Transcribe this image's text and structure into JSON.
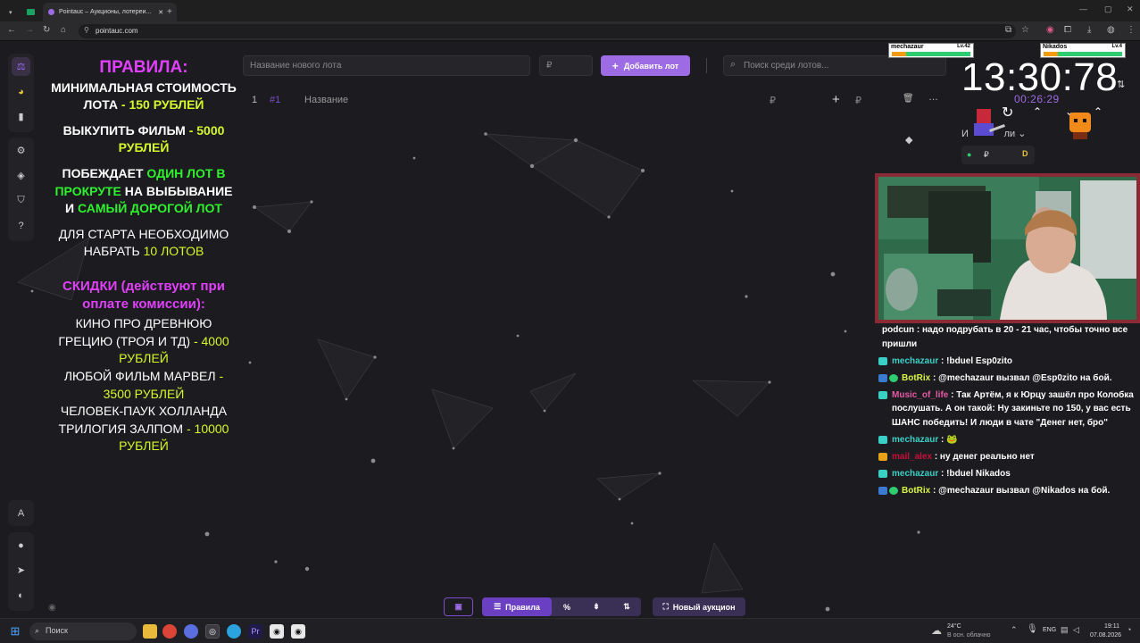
{
  "browser": {
    "tab_label": "Pointauc – Аукционы, лотереи...",
    "new_tab_symbol": "+",
    "url": "pointauc.com"
  },
  "sidebar": {
    "items": [
      {
        "icon": "auction-icon",
        "glyph": "⚖"
      },
      {
        "icon": "pie-chart-icon",
        "glyph": "◕"
      },
      {
        "icon": "bar-chart-icon",
        "glyph": "▮"
      },
      {
        "icon": "gear-icon",
        "glyph": "⚙"
      },
      {
        "icon": "layers-icon",
        "glyph": "◈"
      },
      {
        "icon": "shield-icon",
        "glyph": "⛉"
      },
      {
        "icon": "help-icon",
        "glyph": "?"
      },
      {
        "icon": "translate-icon",
        "glyph": "A"
      },
      {
        "icon": "github-icon",
        "glyph": "●"
      },
      {
        "icon": "telegram-icon",
        "glyph": "➤"
      },
      {
        "icon": "discord-icon",
        "glyph": "◐"
      }
    ]
  },
  "rules": {
    "heading": "ПРАВИЛА:",
    "min_price_text": "МИНИМАЛЬНАЯ СТОИМОСТЬ ЛОТА",
    "min_price_value": "- 150 РУБЛЕЙ",
    "buyout_text": "ВЫКУПИТЬ ФИЛЬМ",
    "buyout_value": "- 5000 РУБЛЕЙ",
    "win_1": "ПОБЕЖДАЕТ",
    "win_2": "ОДИН ЛОТ В ПРОКРУТЕ",
    "win_3": "НА ВЫБЫВАНИЕ И",
    "win_4": "САМЫЙ ДОРОГОЙ ЛОТ",
    "start_text": "ДЛЯ СТАРТА НЕОБХОДИМО НАБРАТЬ",
    "start_value": "10 ЛОТОВ",
    "discount_heading": "СКИДКИ (действуют при оплате комиссии):",
    "d1_text": "КИНО ПРО ДРЕВНЮЮ ГРЕЦИЮ (ТРОЯ И ТД)",
    "d1_value": "- 4000 РУБЛЕЙ",
    "d2_text": "ЛЮБОЙ ФИЛЬМ МАРВЕЛ",
    "d2_value": "- 3500 РУБЛЕЙ",
    "d3_text": "ЧЕЛОВЕК-ПАУК ХОЛЛАНДА ТРИЛОГИЯ ЗАЛПОМ",
    "d3_value": "- 10000 РУБЛЕЙ"
  },
  "top_controls": {
    "new_lot_placeholder": "Название нового лота",
    "price_placeholder": "₽",
    "add_button": "Добавить лот",
    "add_symbol": "+",
    "search_placeholder": "Поиск среди лотов...",
    "search_symbol": "⌕"
  },
  "lot_row": {
    "index": "1",
    "id": "#1",
    "name": "Название",
    "currency": "₽",
    "plus": "+",
    "currency2": "₽",
    "delete_symbol": "🗑",
    "more_symbol": "…"
  },
  "overlay": {
    "player1": {
      "name": "mechazaur",
      "level": "Lv.42"
    },
    "player2": {
      "name": "Nikados",
      "level": "Lv.4"
    },
    "clock": "13:30:78",
    "timer": "00:26:29",
    "partial_label": "И",
    "partial_label_2": "ли",
    "currency_sign": "₽",
    "d_badge": "D"
  },
  "chat": {
    "messages": [
      {
        "nick": "",
        "text": "podcun : надо подрубать в 20 - 21 час, чтобы точно все пришли",
        "color": "#5a8dee"
      },
      {
        "nick": "mechazaur",
        "text": " : !bduel Esp0zito",
        "color": "#3ad0c6"
      },
      {
        "nick": "BotRix",
        "text": " : @mechazaur вызвал @Esp0zito на бой.",
        "color": "#d8f545"
      },
      {
        "nick": "Music_of_life",
        "text": " : Так Артём, я к Юрцу зашёл про Колобка послушать. А он такой: Ну закиньте по 150, у вас есть ШАНС победить! И люди в чате \"Денег нет, бро\"",
        "color": "#e55aa6"
      },
      {
        "nick": "mechazaur",
        "text": " : 🐸",
        "color": "#3ad0c6"
      },
      {
        "nick": "mail_alex",
        "text": " : ну денег реально нет",
        "color": "#c8103c"
      },
      {
        "nick": "mechazaur",
        "text": " : !bduel Nikados",
        "color": "#3ad0c6"
      },
      {
        "nick": "BotRix",
        "text": " : @mechazaur вызвал @Nikados на бой.",
        "color": "#d8f545"
      }
    ]
  },
  "toolbar": {
    "rules_label": "Правила",
    "new_auction_label": "Новый аукцион",
    "percent_symbol": "%",
    "split_symbol": "⇟",
    "sort_symbol": "⇅"
  },
  "taskbar": {
    "search_label": "Поиск",
    "weather_temp": "24°C",
    "weather_text": "В осн. облачно",
    "lang": "ENG",
    "time": "19:11",
    "date": "07.08.2026"
  },
  "colors": {
    "accent": "#9d6be4",
    "pink": "#e040fb",
    "lime": "#d4f82a",
    "green": "#2df22d",
    "bg": "#1c1b1f"
  }
}
